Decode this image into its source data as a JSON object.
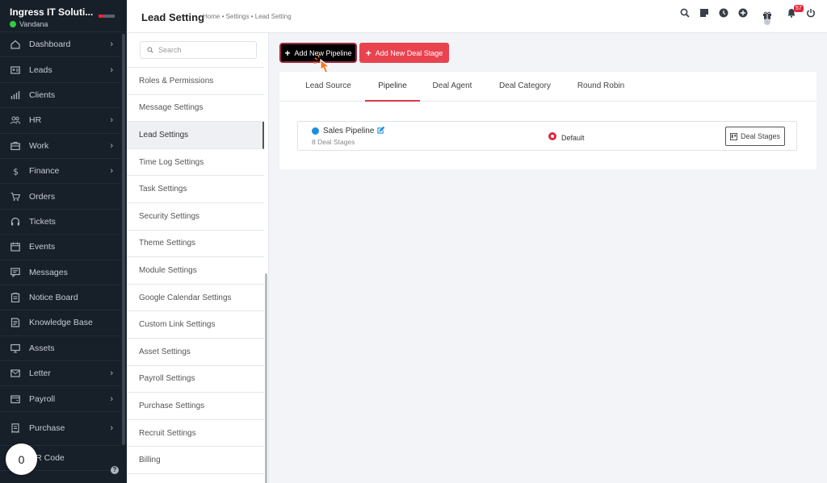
{
  "brand": {
    "name": "Ingress IT Soluti...",
    "user": "Vandana"
  },
  "sidebar": {
    "items": [
      {
        "label": "Dashboard",
        "icon": "home-icon",
        "chevron": true
      },
      {
        "label": "Leads",
        "icon": "id-card-icon",
        "chevron": true
      },
      {
        "label": "Clients",
        "icon": "bar-chart-icon",
        "chevron": false
      },
      {
        "label": "HR",
        "icon": "users-icon",
        "chevron": true
      },
      {
        "label": "Work",
        "icon": "briefcase-icon",
        "chevron": true
      },
      {
        "label": "Finance",
        "icon": "dollar-icon",
        "chevron": true
      },
      {
        "label": "Orders",
        "icon": "cart-icon",
        "chevron": false
      },
      {
        "label": "Tickets",
        "icon": "headset-icon",
        "chevron": false
      },
      {
        "label": "Events",
        "icon": "calendar-icon",
        "chevron": false
      },
      {
        "label": "Messages",
        "icon": "message-icon",
        "chevron": false
      },
      {
        "label": "Notice Board",
        "icon": "clipboard-icon",
        "chevron": false
      },
      {
        "label": "Knowledge Base",
        "icon": "book-icon",
        "chevron": false
      },
      {
        "label": "Assets",
        "icon": "monitor-icon",
        "chevron": false
      },
      {
        "label": "Letter",
        "icon": "envelope-icon",
        "chevron": true
      },
      {
        "label": "Payroll",
        "icon": "wallet-icon",
        "chevron": true
      },
      {
        "label": "Purchase",
        "icon": "receipt-icon",
        "chevron": true
      },
      {
        "label": "QR Code",
        "icon": "qr-icon",
        "chevron": false
      }
    ],
    "counter": "0"
  },
  "header": {
    "title": "Lead Setting",
    "breadcrumb": "Home • Settings • Lead Setting",
    "notification_count": "57"
  },
  "settings_panel": {
    "search_placeholder": "Search",
    "items": [
      "Roles & Permissions",
      "Message Settings",
      "Lead Settings",
      "Time Log Settings",
      "Task Settings",
      "Security Settings",
      "Theme Settings",
      "Module Settings",
      "Google Calendar Settings",
      "Custom Link Settings",
      "Asset Settings",
      "Payroll Settings",
      "Purchase Settings",
      "Recruit Settings",
      "Billing"
    ],
    "active_index": 2
  },
  "actions": {
    "add_pipeline": "Add New Pipeline",
    "add_deal_stage": "Add New Deal Stage"
  },
  "tabs": [
    "Lead Source",
    "Pipeline",
    "Deal Agent",
    "Deal Category",
    "Round Robin"
  ],
  "active_tab": "Pipeline",
  "pipeline": {
    "name": "Sales Pipeline",
    "stages": "8 Deal Stages",
    "default_label": "Default",
    "deal_stages_button": "Deal Stages"
  },
  "colors": {
    "sidebar_bg": "#171f29",
    "accent_red": "#e8434f",
    "pipeline_dot": "#1d8ce0",
    "cursor_orange": "#f07a22"
  }
}
